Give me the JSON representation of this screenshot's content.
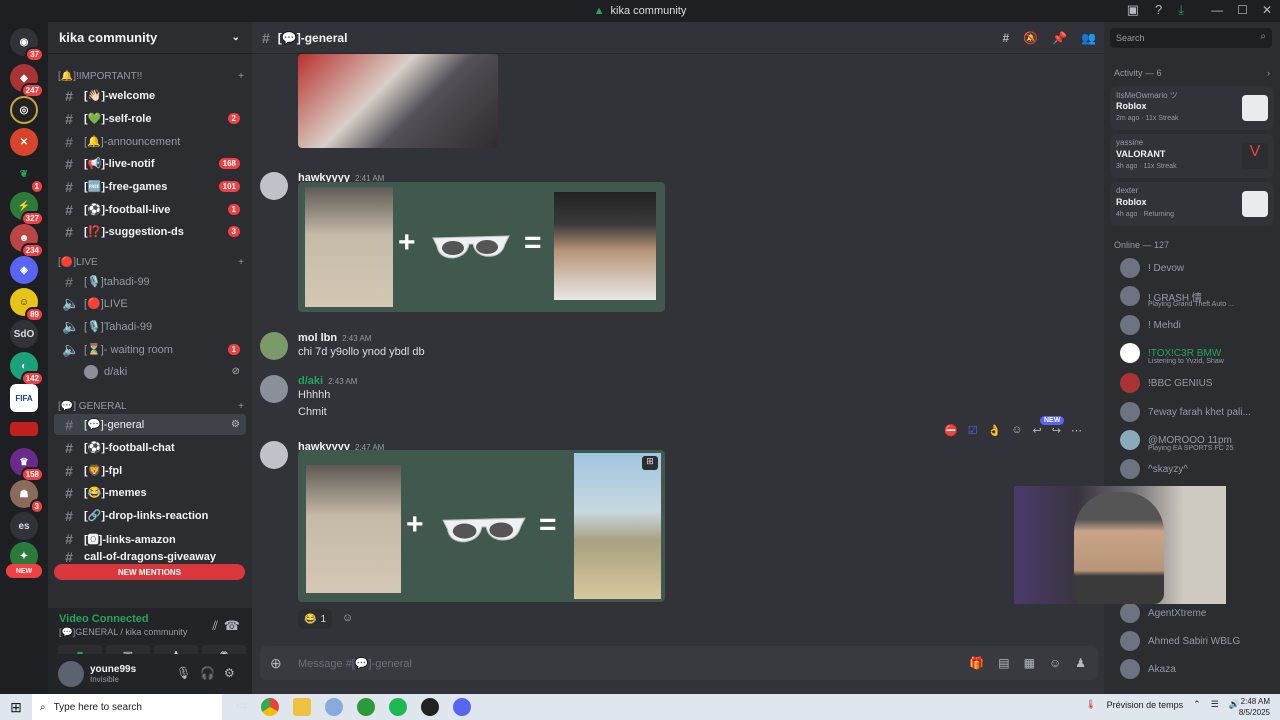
{
  "window": {
    "title": "kika community"
  },
  "server_list": {
    "badges": [
      "37",
      "247",
      "1",
      "327",
      "234",
      "89",
      "142",
      "158",
      "3"
    ],
    "text_servers": [
      "SdO",
      "es"
    ],
    "new_label": "NEW",
    "fifa_label": "FIFA"
  },
  "guild": {
    "name": "kika community"
  },
  "categories": {
    "important": "[🔔]!IMPORTANT!!",
    "live": "[🔴]LIVE",
    "general": "[💬] GENERAL"
  },
  "channels": [
    {
      "label": "[👋🏻]-welcome",
      "badge": ""
    },
    {
      "label": "[💚]-self-role",
      "badge": "2"
    },
    {
      "label": "[🔔]-announcement",
      "badge": ""
    },
    {
      "label": "[📢]-live-notif",
      "badge": "168"
    },
    {
      "label": "[🆓]-free-games",
      "badge": "101"
    },
    {
      "label": "[⚽]-football-live",
      "badge": "1"
    },
    {
      "label": "[⁉️]-suggestion-ds",
      "badge": "3"
    },
    {
      "label": "[🎙️]tahadi-99",
      "badge": ""
    },
    {
      "label": "[🔴]LIVE",
      "badge": ""
    },
    {
      "label": "[🎙️]Tahadi-99",
      "badge": ""
    },
    {
      "label": "[⏳]- waiting room",
      "badge": "1"
    },
    {
      "label": "d/aki",
      "badge": ""
    },
    {
      "label": "[💬]-general",
      "badge": ""
    },
    {
      "label": "[⚽]-football-chat",
      "badge": ""
    },
    {
      "label": "[🦁]-fpl",
      "badge": ""
    },
    {
      "label": "[😂]-memes",
      "badge": ""
    },
    {
      "label": "[🔗]-drop-links-reaction",
      "badge": ""
    },
    {
      "label": "[🅾]-links-amazon",
      "badge": ""
    },
    {
      "label": "call-of-dragons-giveaway",
      "badge": ""
    }
  ],
  "new_mentions": "NEW MENTIONS",
  "voice": {
    "status": "Video Connected",
    "channel": "[💬]GENERAL / kika community"
  },
  "user": {
    "name": "youne99s",
    "status": "Invisible"
  },
  "chat": {
    "channel": "[💬]-general",
    "messages": [
      {
        "author": "hawkyyyy",
        "time": "2:41 AM",
        "text": ""
      },
      {
        "author": "mol lbn",
        "time": "2:43 AM",
        "text": "chi 7d y9ollo ynod ybdl db"
      },
      {
        "author": "d/aki",
        "time": "2:43 AM",
        "text": "Hhhhh",
        "text2": "Chmit"
      },
      {
        "author": "hawkyyyy",
        "time": "2:47 AM",
        "text": ""
      }
    ],
    "reaction_count": "1",
    "new_tag": "NEW",
    "composer_placeholder": "Message #[💬]-general"
  },
  "search": {
    "placeholder": "Search"
  },
  "activity": {
    "header": "Activity — 6",
    "items": [
      {
        "user": "ItsMeOwmario ツ",
        "game": "Roblox",
        "meta": "2m ago · 11x Streak"
      },
      {
        "user": "yassine",
        "game": "VALORANT",
        "meta": "3h ago · 11x Streak"
      },
      {
        "user": "dexter",
        "game": "Roblox",
        "meta": "4h ago · Returning"
      }
    ]
  },
  "members": {
    "online_header": "Online — 127",
    "list": [
      {
        "name": "! Devow",
        "status": ""
      },
      {
        "name": "! GRASH 情",
        "status": "Playing Grand Theft Auto ..."
      },
      {
        "name": "! Mehdi",
        "status": ""
      },
      {
        "name": "!TOX!C3R BMW",
        "status": "Listening to Yvzid, Shaw"
      },
      {
        "name": "!BBC GENIUS",
        "status": ""
      },
      {
        "name": "7eway farah khet pali...",
        "status": ""
      },
      {
        "name": "@MOROOO 11pm",
        "status": "Playing EA SPORTS FC 25"
      },
      {
        "name": "^skayzy^",
        "status": ""
      },
      {
        "name": "AgentXtreme",
        "status": ""
      },
      {
        "name": "Ahmed Sabiri WBLG",
        "status": ""
      },
      {
        "name": "Akaza",
        "status": ""
      }
    ]
  },
  "taskbar": {
    "search": "Type here to search",
    "weather": "Prévision de temps",
    "time": "2:48 AM",
    "date": "8/5/2025"
  },
  "colors": {
    "accent": "#5865f2",
    "danger": "#f23f43",
    "online": "#23a55a",
    "embed": "#40584e"
  }
}
